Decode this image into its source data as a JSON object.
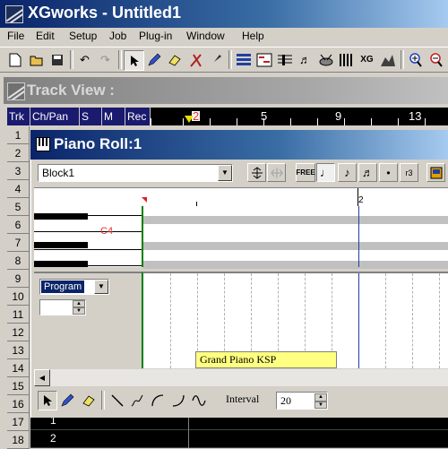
{
  "app": {
    "title": "XGworks - Untitled1",
    "icon": "xgworks-app-icon"
  },
  "menu": [
    "File",
    "Edit",
    "Setup",
    "Job",
    "Plug-in",
    "Window",
    "Help"
  ],
  "toolbar": {
    "buttons": [
      "new-icon",
      "open-icon",
      "save-icon",
      "undo-icon",
      "redo-icon",
      "arrow-icon",
      "pencil-icon",
      "eraser-icon",
      "scissors-icon",
      "glue-icon",
      "track-view-icon",
      "piano-roll-icon",
      "staff-icon",
      "score-icon",
      "drum-icon",
      "event-list-icon",
      "xg-editor-icon",
      "mixer-icon",
      "zoom-in-icon",
      "zoom-out-icon"
    ],
    "selected": "arrow-icon"
  },
  "track_view": {
    "title": "Track View :",
    "headers": [
      "Trk",
      "Ch/Pan",
      "S",
      "M",
      "Rec"
    ],
    "ruler": [
      "5",
      "9",
      "13"
    ],
    "marker": "2",
    "row_numbers": [
      "1",
      "2",
      "3",
      "4",
      "5",
      "6",
      "7",
      "8",
      "9",
      "10",
      "11",
      "12",
      "13",
      "14",
      "15",
      "16",
      "17",
      "18"
    ],
    "track_cells": [
      "1",
      "2"
    ]
  },
  "piano_roll": {
    "title": "Piano Roll:1",
    "block": "Block1",
    "toolbar_buttons": [
      "FREE",
      "r3"
    ],
    "ruler_marker": "2",
    "key_label": "C4",
    "controller": {
      "selected": "Program",
      "value": ""
    },
    "event_label": "Grand Piano KSP",
    "interval_label": "Interval",
    "interval_value": "20"
  },
  "colors": {
    "title_active": "#0a246a",
    "title_inactive": "#808080",
    "track_header": "#1a1a6e",
    "event_block": "#ffff80",
    "play_line": "#008000"
  }
}
